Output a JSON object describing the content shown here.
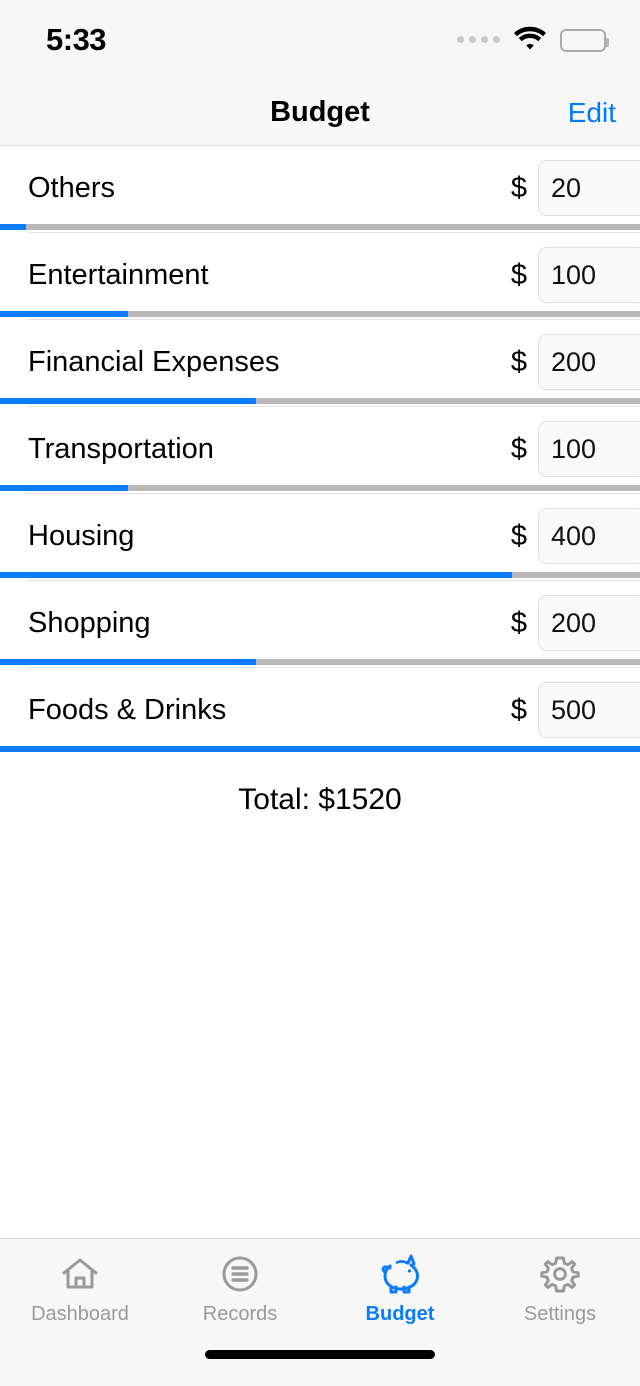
{
  "status_bar": {
    "time": "5:33",
    "signal_icon": "signal-dots-icon",
    "wifi_icon": "wifi-icon",
    "battery_icon": "battery-full-icon"
  },
  "nav": {
    "title": "Budget",
    "edit_label": "Edit",
    "accent_color": "#007aff"
  },
  "budget": {
    "currency_symbol": "$",
    "max_value": 500,
    "progress_color": "#0a7cff",
    "track_color": "#b8b8b8",
    "items": [
      {
        "category": "Others",
        "amount": "20",
        "value": 20,
        "percent": 4
      },
      {
        "category": "Entertainment",
        "amount": "100",
        "value": 100,
        "percent": 20
      },
      {
        "category": "Financial Expenses",
        "amount": "200",
        "value": 200,
        "percent": 40
      },
      {
        "category": "Transportation",
        "amount": "100",
        "value": 100,
        "percent": 20
      },
      {
        "category": "Housing",
        "amount": "400",
        "value": 400,
        "percent": 80
      },
      {
        "category": "Shopping",
        "amount": "200",
        "value": 200,
        "percent": 40
      },
      {
        "category": "Foods & Drinks",
        "amount": "500",
        "value": 500,
        "percent": 100
      }
    ]
  },
  "total": {
    "text": "Total: $1520",
    "value": 1520
  },
  "tabbar": {
    "active_color": "#0a7cff",
    "inactive_color": "#9a9a9a",
    "tabs": [
      {
        "label": "Dashboard",
        "icon": "home-icon",
        "active": false
      },
      {
        "label": "Records",
        "icon": "list-circle-icon",
        "active": false
      },
      {
        "label": "Budget",
        "icon": "piggy-bank-icon",
        "active": true
      },
      {
        "label": "Settings",
        "icon": "gear-icon",
        "active": false
      }
    ]
  }
}
